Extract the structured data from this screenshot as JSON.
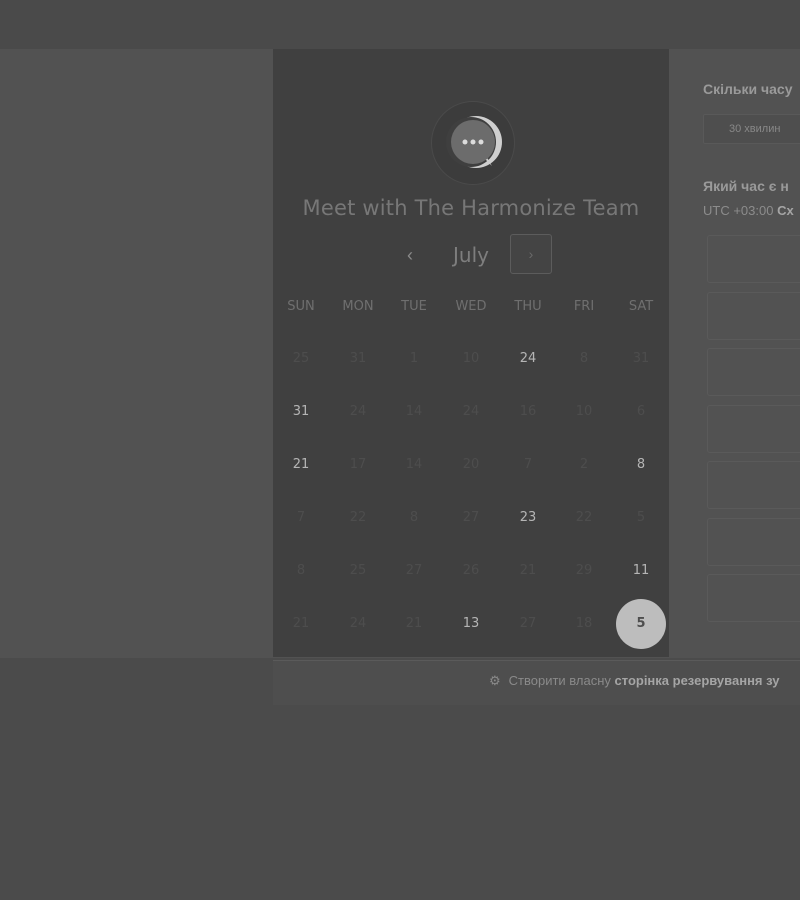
{
  "header": {
    "title": "Meet with The Harmonize Team",
    "month": "July",
    "prev_icon": "chevron-left-icon",
    "next_icon": "chevron-right-icon"
  },
  "weekdays": [
    "SUN",
    "MON",
    "TUE",
    "WED",
    "THU",
    "FRI",
    "SAT"
  ],
  "days": [
    [
      {
        "label": "25",
        "available": false
      },
      {
        "label": "31",
        "available": false
      },
      {
        "label": "1",
        "available": false
      },
      {
        "label": "10",
        "available": false
      },
      {
        "label": "24",
        "available": true
      },
      {
        "label": "8",
        "available": false
      },
      {
        "label": "31",
        "available": false
      }
    ],
    [
      {
        "label": "31",
        "available": true
      },
      {
        "label": "24",
        "available": false
      },
      {
        "label": "14",
        "available": false
      },
      {
        "label": "24",
        "available": false
      },
      {
        "label": "16",
        "available": false
      },
      {
        "label": "10",
        "available": false
      },
      {
        "label": "6",
        "available": false
      }
    ],
    [
      {
        "label": "21",
        "available": true
      },
      {
        "label": "17",
        "available": false
      },
      {
        "label": "14",
        "available": false
      },
      {
        "label": "20",
        "available": false
      },
      {
        "label": "7",
        "available": false
      },
      {
        "label": "2",
        "available": false
      },
      {
        "label": "8",
        "available": true
      }
    ],
    [
      {
        "label": "7",
        "available": false
      },
      {
        "label": "22",
        "available": false
      },
      {
        "label": "8",
        "available": false
      },
      {
        "label": "27",
        "available": false
      },
      {
        "label": "23",
        "available": true
      },
      {
        "label": "22",
        "available": false
      },
      {
        "label": "5",
        "available": false
      }
    ],
    [
      {
        "label": "8",
        "available": false
      },
      {
        "label": "25",
        "available": false
      },
      {
        "label": "27",
        "available": false
      },
      {
        "label": "26",
        "available": false
      },
      {
        "label": "21",
        "available": false
      },
      {
        "label": "29",
        "available": false
      },
      {
        "label": "11",
        "available": true
      }
    ],
    [
      {
        "label": "21",
        "available": false
      },
      {
        "label": "24",
        "available": false
      },
      {
        "label": "21",
        "available": false
      },
      {
        "label": "13",
        "available": true
      },
      {
        "label": "27",
        "available": false
      },
      {
        "label": "18",
        "available": false
      },
      {
        "label": "5",
        "available": true,
        "selected": true
      }
    ]
  ],
  "duration": {
    "title": "Скільки часу",
    "option": "30 хвилин"
  },
  "time": {
    "title": "Який час є н",
    "tz_prefix": "UTC +03:00",
    "tz_name": "Сх"
  },
  "slots": [
    "",
    "",
    "",
    "",
    "",
    "",
    ""
  ],
  "footer": {
    "icon": "sprocket-icon",
    "text": "Створити власну",
    "link": "сторінка резервування зу"
  },
  "colors": {
    "selected_day": "#bdbdbd",
    "panel": "#404040"
  }
}
